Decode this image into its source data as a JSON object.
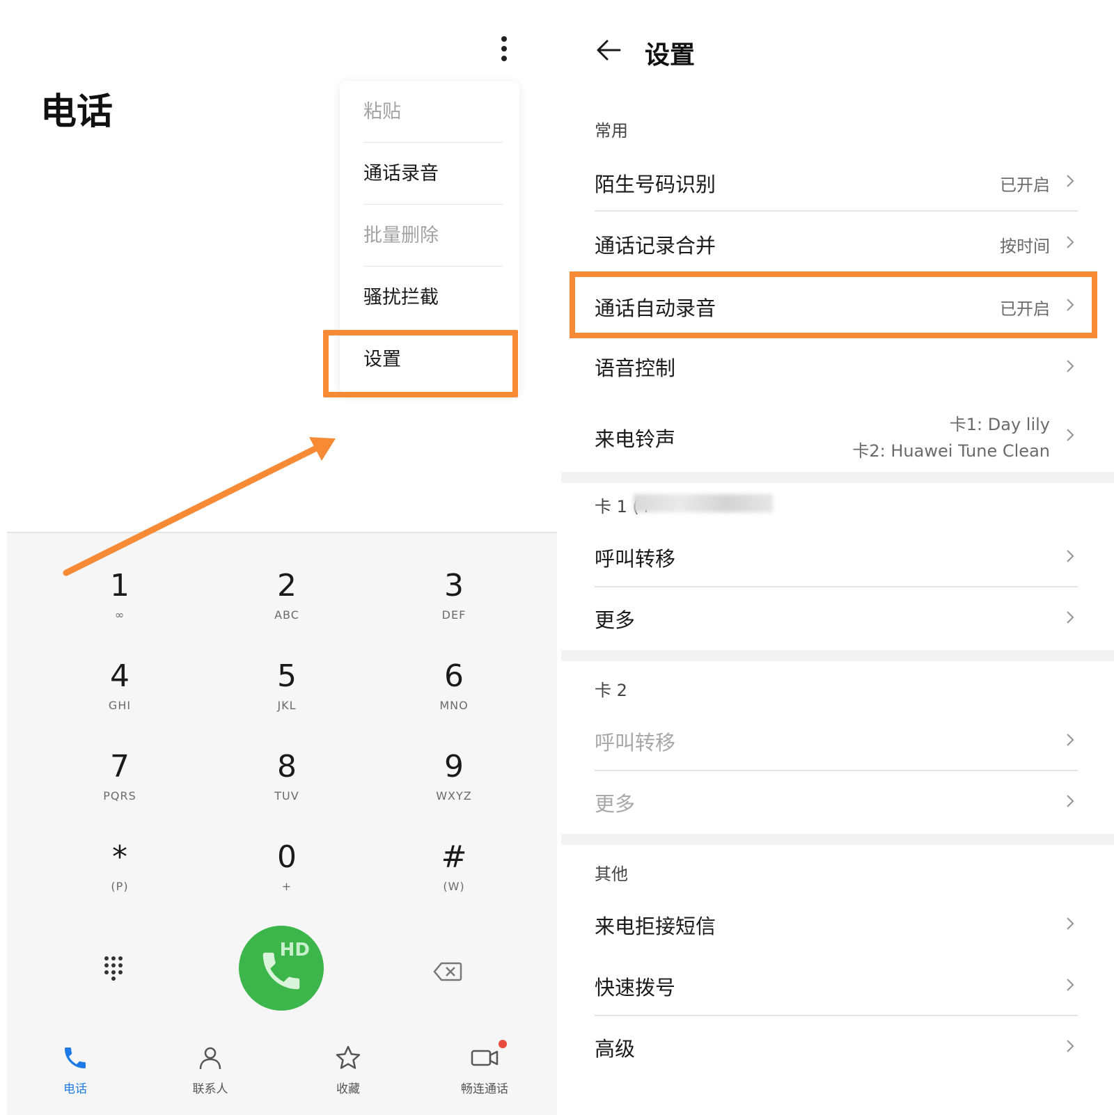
{
  "left": {
    "app_title": "电话",
    "menu": [
      {
        "label": "粘贴",
        "disabled": true
      },
      {
        "label": "通话录音",
        "disabled": false
      },
      {
        "label": "批量删除",
        "disabled": true
      },
      {
        "label": "骚扰拦截",
        "disabled": false
      },
      {
        "label": "设置",
        "disabled": false
      }
    ],
    "keys": [
      {
        "digit": "1",
        "sub": "∞"
      },
      {
        "digit": "2",
        "sub": "ABC"
      },
      {
        "digit": "3",
        "sub": "DEF"
      },
      {
        "digit": "4",
        "sub": "GHI"
      },
      {
        "digit": "5",
        "sub": "JKL"
      },
      {
        "digit": "6",
        "sub": "MNO"
      },
      {
        "digit": "7",
        "sub": "PQRS"
      },
      {
        "digit": "8",
        "sub": "TUV"
      },
      {
        "digit": "9",
        "sub": "WXYZ"
      },
      {
        "digit": "*",
        "sub": "(P)"
      },
      {
        "digit": "0",
        "sub": "+"
      },
      {
        "digit": "#",
        "sub": "(W)"
      }
    ],
    "call_badge": "HD",
    "tabs": [
      {
        "label": "电话",
        "icon": "phone-icon",
        "active": true
      },
      {
        "label": "联系人",
        "icon": "contacts-icon",
        "active": false
      },
      {
        "label": "收藏",
        "icon": "star-icon",
        "active": false
      },
      {
        "label": "畅连通话",
        "icon": "video-call-icon",
        "active": false
      }
    ],
    "accent": "#3cb54a",
    "tab_active_color": "#1e7ae6",
    "highlight_color": "#f68a35"
  },
  "right": {
    "title": "设置",
    "sections": {
      "common": "常用",
      "card1": "卡 1 (+",
      "card2": "卡 2",
      "other": "其他"
    },
    "rows": {
      "stranger": {
        "title": "陌生号码识别",
        "value": "已开启"
      },
      "merge": {
        "title": "通话记录合并",
        "value": "按时间"
      },
      "autorec": {
        "title": "通话自动录音",
        "value": "已开启"
      },
      "voice": {
        "title": "语音控制"
      },
      "ringtone": {
        "title": "来电铃声",
        "value1": "卡1: Day lily",
        "value2": "卡2: Huawei Tune Clean"
      },
      "c1_forward": {
        "title": "呼叫转移"
      },
      "c1_more": {
        "title": "更多"
      },
      "c2_forward": {
        "title": "呼叫转移"
      },
      "c2_more": {
        "title": "更多"
      },
      "reject_sms": {
        "title": "来电拒接短信"
      },
      "speed_dial": {
        "title": "快速拨号"
      },
      "advanced": {
        "title": "高级"
      }
    }
  }
}
